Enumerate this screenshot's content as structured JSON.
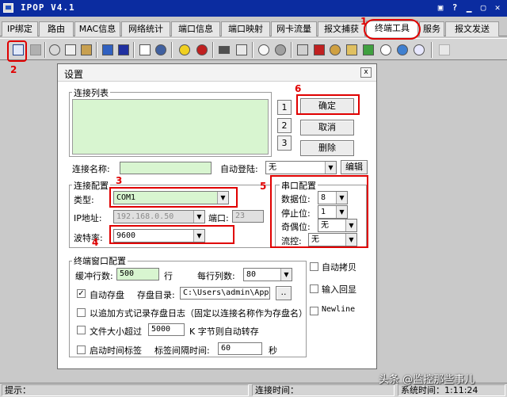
{
  "window": {
    "title": "IPOP V4.1",
    "help_glyph": "?"
  },
  "tabs": [
    {
      "label": "IP绑定"
    },
    {
      "label": "路由"
    },
    {
      "label": "MAC信息"
    },
    {
      "label": "网络统计"
    },
    {
      "label": "端口信息"
    },
    {
      "label": "端口映射"
    },
    {
      "label": "网卡流量"
    },
    {
      "label": "报文捕获"
    },
    {
      "label": "终端工具",
      "active": true
    },
    {
      "label": "服务"
    },
    {
      "label": "报文发送"
    }
  ],
  "annotations": {
    "n1": "1",
    "n2": "2",
    "n3": "3",
    "n4": "4",
    "n5": "5",
    "n6": "6",
    "color": "#e00000"
  },
  "toolbar": {
    "icons": [
      "terminal-settings-icon",
      "delete-icon",
      "cut-icon",
      "copy-icon",
      "paste-icon",
      "connect-icon",
      "disconnect-icon",
      "print-icon",
      "users-icon",
      "star-icon",
      "stop-icon",
      "keyboard-icon",
      "log-icon",
      "search-icon",
      "gear-icon",
      "grid-icon",
      "font-icon",
      "tools-icon",
      "script-icon",
      "run-icon",
      "zoom-icon",
      "refresh-icon",
      "help-icon"
    ]
  },
  "dialog": {
    "title": "设置",
    "close_glyph": "x",
    "conn_list": {
      "label": "连接列表",
      "side_buttons": [
        "1",
        "2",
        "3"
      ],
      "confirm": "确定",
      "cancel": "取消",
      "delete": "删除"
    },
    "conn_name_label": "连接名称:",
    "conn_name_value": "",
    "auto_login_label": "自动登陆:",
    "auto_login_value": "无",
    "edit_button": "编辑",
    "conn_config": {
      "label": "连接配置",
      "type_label": "类型:",
      "type_value": "COM1",
      "ip_label": "IP地址:",
      "ip_value": "192.168.0.50",
      "port_label": "端口:",
      "port_value": "23",
      "baud_label": "波特率:",
      "baud_value": "9600"
    },
    "serial_config": {
      "label": "串口配置",
      "databits_label": "数据位:",
      "databits_value": "8",
      "stopbits_label": "停止位:",
      "stopbits_value": "1",
      "parity_label": "奇偶位:",
      "parity_value": "无",
      "flow_label": "流控:",
      "flow_value": "无"
    },
    "term_config": {
      "label": "终端窗口配置",
      "buffer_label": "缓冲行数:",
      "buffer_value": "500",
      "buffer_unit": "行",
      "cols_label": "每行列数:",
      "cols_value": "80",
      "autosave_label": "自动存盘",
      "autosave_checked": true,
      "savedir_label": "存盘目录:",
      "savedir_value": "C:\\Users\\admin\\AppDa",
      "browse_label": "..",
      "append_label": "以追加方式记录存盘日志（固定以连接名称作为存盘名）",
      "filesize_label": "文件大小超过",
      "filesize_value": "5000",
      "filesize_unit": "K 字节则自动转存",
      "timestamp_label": "启动时间标签",
      "interval_label": "标签间隔时间:",
      "interval_value": "60",
      "interval_unit": "秒",
      "auto_copy_label": "自动拷贝",
      "echo_label": "输入回显",
      "newline_label": "Newline"
    }
  },
  "status": {
    "hint_label": "提示：",
    "conn_time_label": "连接时间：",
    "sys_time_label": "系统时间：1:11:24"
  },
  "watermark": "头条 @监控那些事儿"
}
